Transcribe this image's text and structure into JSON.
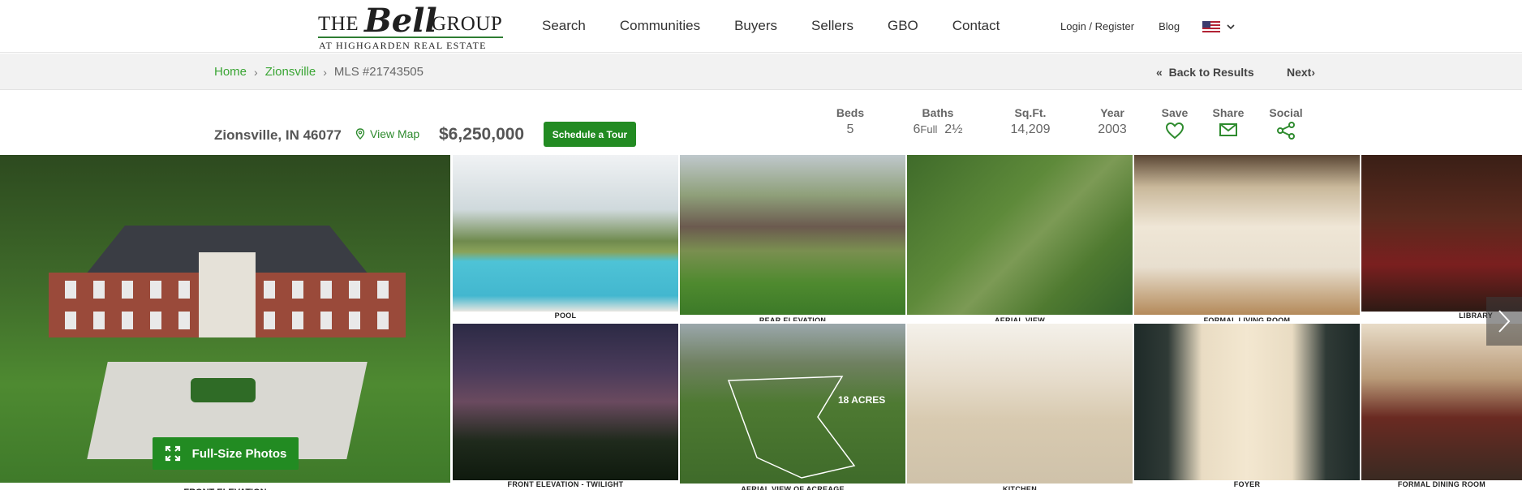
{
  "brand": {
    "logo_the": "THE",
    "logo_bell": "Bell",
    "logo_group": "GROUP",
    "logo_sub": "AT HIGHGARDEN REAL ESTATE"
  },
  "nav": {
    "items": [
      "Search",
      "Communities",
      "Buyers",
      "Sellers",
      "GBO",
      "Contact"
    ],
    "login": "Login / Register",
    "blog": "Blog",
    "language_icon": "us-flag-icon"
  },
  "breadcrumb": {
    "home": "Home",
    "city": "Zionsville",
    "mls": "MLS #21743505",
    "back": "Back to Results",
    "next": "Next"
  },
  "listing": {
    "address": "Zionsville, IN 46077",
    "view_map": "View Map",
    "price": "$6,250,000",
    "tour": "Schedule a Tour",
    "stats": {
      "beds_label": "Beds",
      "beds": "5",
      "baths_label": "Baths",
      "baths_full": "6",
      "baths_full_suffix": "Full",
      "baths_half": "2½",
      "sqft_label": "Sq.Ft.",
      "sqft": "14,209",
      "year_label": "Year",
      "year": "2003"
    },
    "actions": {
      "save": "Save",
      "share": "Share",
      "social": "Social"
    }
  },
  "gallery": {
    "fullsize": "Full-Size Photos",
    "main_caption": "FRONT ELEVATION",
    "captions": [
      "POOL",
      "REAR ELEVATION",
      "AERIAL VIEW",
      "FORMAL LIVING ROOM",
      "LIBRARY",
      "FRONT ELEVATION - TWILIGHT",
      "AERIAL VIEW OF ACREAGE",
      "KITCHEN",
      "FOYER",
      "FORMAL DINING ROOM"
    ],
    "overlay_text": "18 ACRES"
  },
  "colors": {
    "brand_green": "#228b22",
    "link_green": "#3aa534"
  }
}
